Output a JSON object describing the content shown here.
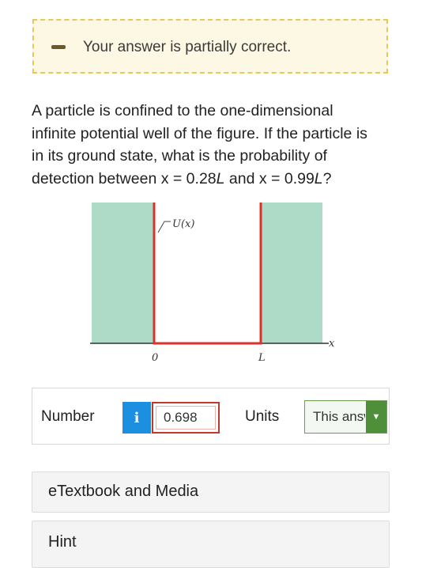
{
  "feedback": {
    "message": "Your answer is partially correct.",
    "icon": "minus-icon",
    "accent": "#e8c85a"
  },
  "question": {
    "line1": "A particle is confined to the one-dimensional",
    "line2": "infinite potential well of the figure. If the particle is",
    "line3": "in its ground state, what is the probability of",
    "line4_prefix": "detection between x = 0.28",
    "line4_var1": "L",
    "line4_mid": " and x = 0.99",
    "line4_var2": "L",
    "line4_suffix": "?"
  },
  "figure": {
    "potential_label": "U(x)",
    "x_label": "x",
    "tick_zero": "0",
    "tick_L": "L"
  },
  "answer": {
    "number_label": "Number",
    "info_label": "i",
    "number_value": "0.698",
    "units_label": "Units",
    "units_value": "This answer has no units"
  },
  "panels": {
    "etextbook_label": "eTextbook and Media",
    "hint_label": "Hint"
  }
}
